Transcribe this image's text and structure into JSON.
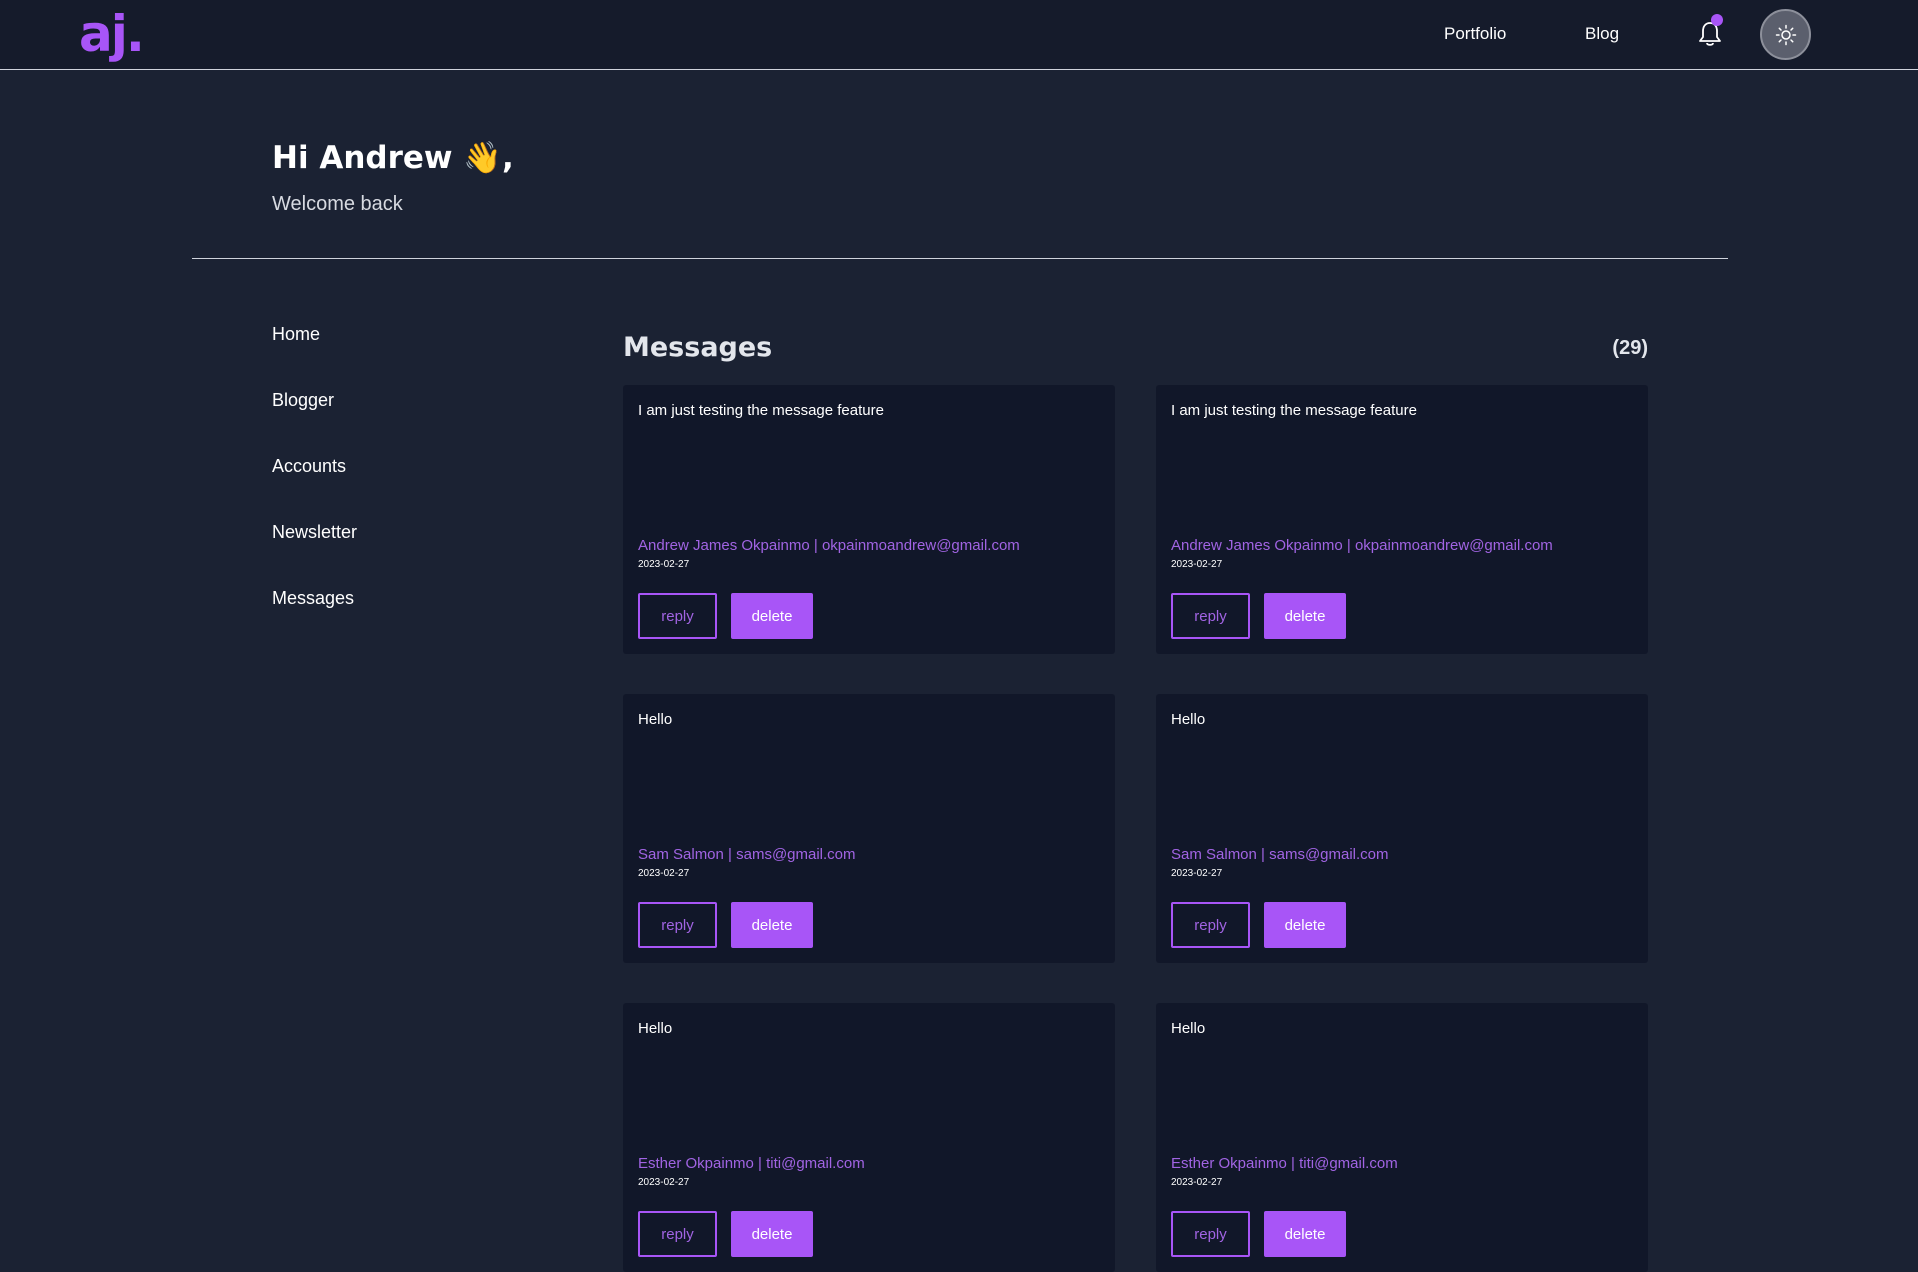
{
  "header": {
    "logo": "aj.",
    "nav": [
      {
        "label": "Portfolio"
      },
      {
        "label": "Blog"
      }
    ],
    "bell_icon": "bell-icon",
    "theme_icon": "sun-icon"
  },
  "greeting": {
    "title": "Hi Andrew 👋,",
    "subtitle": "Welcome back"
  },
  "sidebar": {
    "items": [
      {
        "label": "Home"
      },
      {
        "label": "Blogger"
      },
      {
        "label": "Accounts"
      },
      {
        "label": "Newsletter"
      },
      {
        "label": "Messages"
      }
    ]
  },
  "messages": {
    "title": "Messages",
    "count": "(29)",
    "reply_label": "reply",
    "delete_label": "delete",
    "items": [
      {
        "text": "I am just testing the message feature",
        "from": "Andrew James Okpainmo | okpainmoandrew@gmail.com",
        "date": "2023-02-27"
      },
      {
        "text": "I am just testing the message feature",
        "from": "Andrew James Okpainmo | okpainmoandrew@gmail.com",
        "date": "2023-02-27"
      },
      {
        "text": "Hello",
        "from": "Sam Salmon | sams@gmail.com",
        "date": "2023-02-27"
      },
      {
        "text": "Hello",
        "from": "Sam Salmon | sams@gmail.com",
        "date": "2023-02-27"
      },
      {
        "text": "Hello",
        "from": "Esther Okpainmo | titi@gmail.com",
        "date": "2023-02-27"
      },
      {
        "text": "Hello",
        "from": "Esther Okpainmo | titi@gmail.com",
        "date": "2023-02-27"
      }
    ]
  },
  "colors": {
    "accent": "#a855f7",
    "background": "#1b2233",
    "card": "#111729"
  }
}
